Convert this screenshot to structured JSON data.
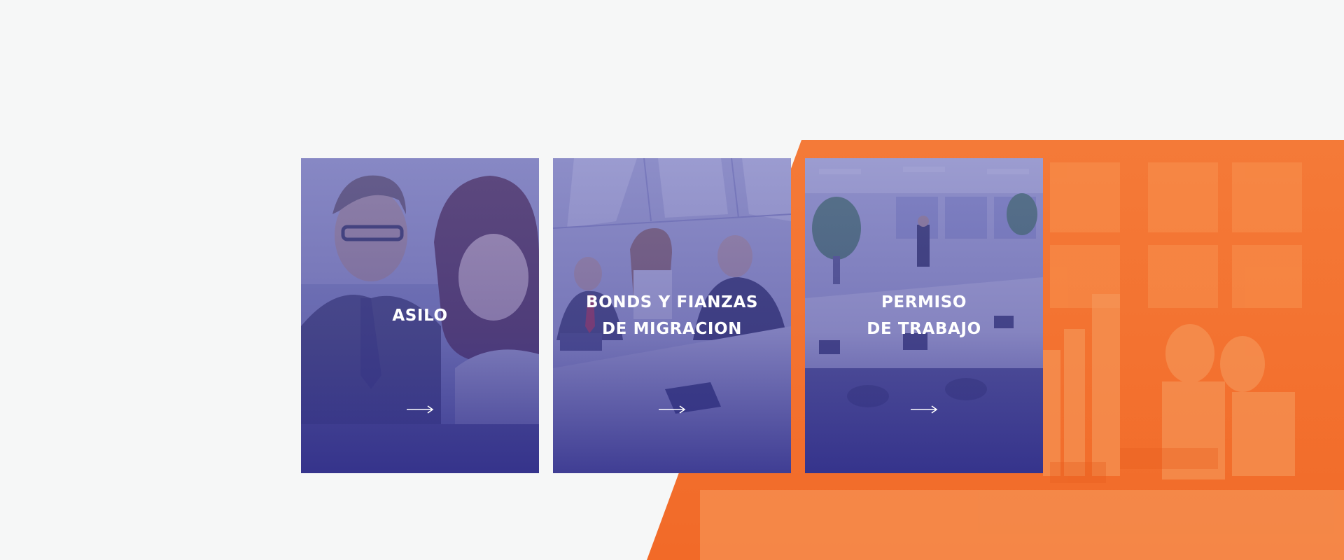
{
  "colors": {
    "page_background": "#f6f7f7",
    "accent_orange": "#f36f2f",
    "card_overlay_indigo": "#3a3896",
    "card_text": "#ffffff"
  },
  "cards": [
    {
      "title": "ASILO",
      "arrow_icon": "arrow-right-icon",
      "photo": "business-meeting-photo"
    },
    {
      "title": "BONDS Y FIANZAS\nDE MIGRACION",
      "arrow_icon": "arrow-right-icon",
      "photo": "conference-table-photo"
    },
    {
      "title": "PERMISO\nDE TRABAJO",
      "arrow_icon": "arrow-right-icon",
      "photo": "open-office-photo"
    }
  ]
}
